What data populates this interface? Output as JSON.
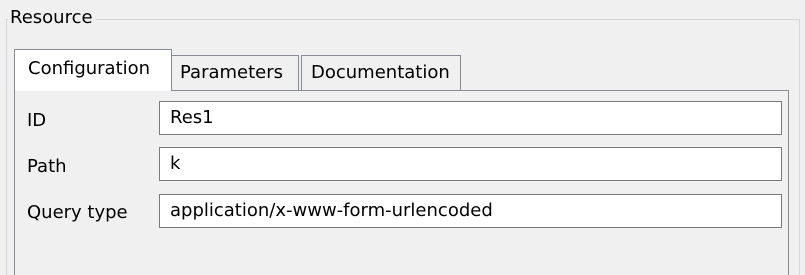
{
  "group": {
    "title": "Resource"
  },
  "tabs": [
    {
      "label": "Configuration",
      "selected": true
    },
    {
      "label": "Parameters",
      "selected": false
    },
    {
      "label": "Documentation",
      "selected": false
    }
  ],
  "fields": [
    {
      "label": "ID",
      "value": "Res1"
    },
    {
      "label": "Path",
      "value": "k"
    },
    {
      "label": "Query type",
      "value": "application/x-www-form-urlencoded"
    }
  ],
  "colors": {
    "background": "#f0f0f0",
    "field_background": "#ffffff",
    "tab_border": "#898c95",
    "group_border": "#d5d5d5"
  }
}
